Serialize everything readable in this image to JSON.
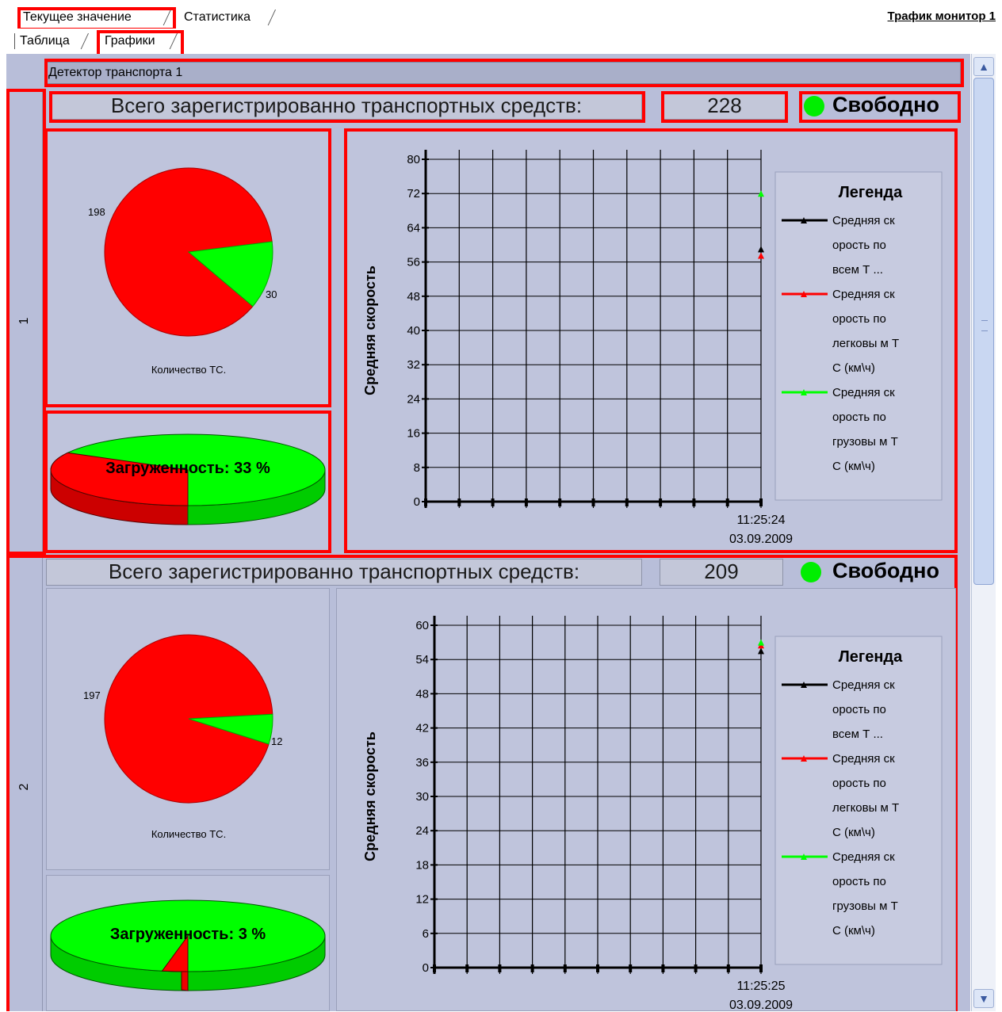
{
  "window": {
    "top_tabs": [
      {
        "label": "Текущее значение",
        "active": true
      },
      {
        "label": "Статистика",
        "active": false
      }
    ],
    "window_title": "Трафик монитор 1",
    "sub_tabs": [
      {
        "label": "Таблица",
        "active": false
      },
      {
        "label": "Графики",
        "active": true
      }
    ],
    "detector_title": "Детектор транспорта 1"
  },
  "colors": {
    "accent_red": "#ff0000",
    "green": "#00ff00",
    "panel_bg": "#b8bed9"
  },
  "rows": [
    {
      "row_number": "1",
      "total_label": "Всего зарегистрированно транспортных средств:",
      "total_value": "228",
      "status": "Свободно",
      "pie": {
        "title": "Количество ТС.",
        "red_value": 198,
        "green_value": 30,
        "red_label": "198",
        "green_label": "30"
      },
      "load": {
        "label": "Загруженность: 33 %",
        "percent": 33
      },
      "chart_data": {
        "type": "line",
        "ylabel": "Средняя скорость",
        "ylim": [
          0,
          80
        ],
        "yticks": [
          "80",
          "72",
          "64",
          "56",
          "48",
          "40",
          "32",
          "24",
          "16",
          "8",
          "0"
        ],
        "x": [
          "11:25:24"
        ],
        "x_date": "03.09.2009",
        "series": [
          {
            "name": "Средняя скорость по всем ТС (км/ч)",
            "color": "#000000",
            "values": [
              59
            ]
          },
          {
            "name": "Средняя скорость по легковым ТС (км/ч)",
            "color": "#ff0000",
            "values": [
              57.5
            ]
          },
          {
            "name": "Средняя скорость по грузовым ТС (км/ч)",
            "color": "#00ff00",
            "values": [
              72
            ]
          }
        ],
        "legend": {
          "title": "Легенда",
          "entries": [
            {
              "lines": [
                "Средняя ск",
                "орость по",
                "всем Т ..."
              ]
            },
            {
              "lines": [
                "Средняя ск",
                "орость по",
                "легковы м Т",
                "С (км\\ч)"
              ]
            },
            {
              "lines": [
                "Средняя ск",
                "орость по",
                "грузовы м Т",
                "С (км\\ч)"
              ]
            }
          ]
        }
      }
    },
    {
      "row_number": "2",
      "total_label": "Всего зарегистрированно транспортных средств:",
      "total_value": "209",
      "status": "Свободно",
      "pie": {
        "title": "Количество ТС.",
        "red_value": 197,
        "green_value": 12,
        "red_label": "197",
        "green_label": "12"
      },
      "load": {
        "label": "Загруженность: 3 %",
        "percent": 3
      },
      "chart_data": {
        "type": "line",
        "ylabel": "Средняя скорость",
        "ylim": [
          0,
          60
        ],
        "yticks": [
          "60",
          "54",
          "48",
          "42",
          "36",
          "30",
          "24",
          "18",
          "12",
          "6",
          "0"
        ],
        "x": [
          "11:25:25"
        ],
        "x_date": "03.09.2009",
        "series": [
          {
            "name": "Средняя скорость по всем ТС (км/ч)",
            "color": "#000000",
            "values": [
              55.5
            ]
          },
          {
            "name": "Средняя скорость по легковым ТС (км/ч)",
            "color": "#ff0000",
            "values": [
              56.5
            ]
          },
          {
            "name": "Средняя скорость по грузовым ТС (км/ч)",
            "color": "#00ff00",
            "values": [
              57
            ]
          }
        ],
        "legend": {
          "title": "Легенда",
          "entries": [
            {
              "lines": [
                "Средняя ск",
                "орость по",
                "всем Т ..."
              ]
            },
            {
              "lines": [
                "Средняя ск",
                "орость по",
                "легковы м Т",
                "С (км\\ч)"
              ]
            },
            {
              "lines": [
                "Средняя ск",
                "орость по",
                "грузовы м Т",
                "С (км\\ч)"
              ]
            }
          ]
        }
      }
    }
  ]
}
